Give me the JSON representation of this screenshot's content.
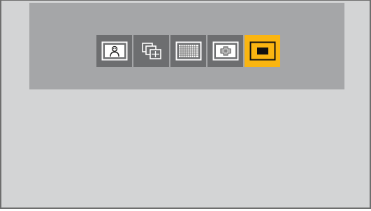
{
  "menu": {
    "options": [
      {
        "id": "face-detection",
        "icon": "face-portrait-icon",
        "selected": false
      },
      {
        "id": "tracking",
        "icon": "multi-frame-tracking-icon",
        "selected": false
      },
      {
        "id": "multi-area",
        "icon": "grid-area-icon",
        "selected": false
      },
      {
        "id": "custom-multi",
        "icon": "custom-cross-area-icon",
        "selected": false
      },
      {
        "id": "single-area",
        "icon": "single-area-icon",
        "selected": true
      }
    ],
    "colors": {
      "selected": "#fab511",
      "unselected": "#6d6e70",
      "panel": "#a5a6a8",
      "background": "#d3d4d5"
    }
  }
}
